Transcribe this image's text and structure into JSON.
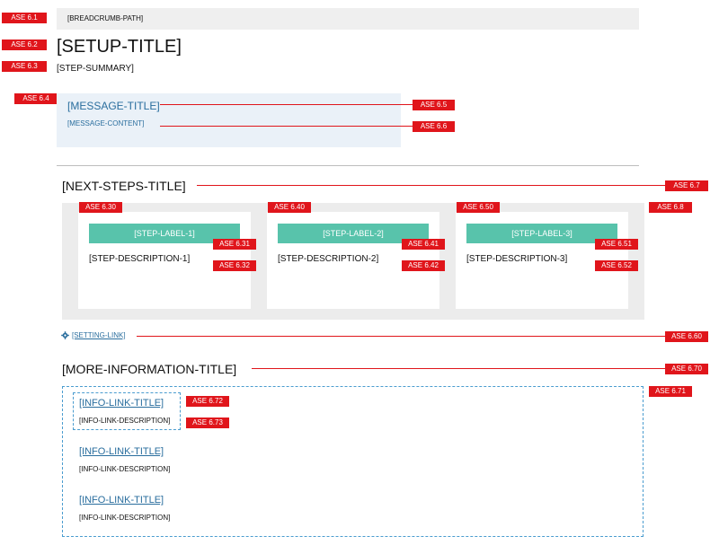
{
  "breadcrumb": "[BREADCRUMB-PATH]",
  "setup_title": "[SETUP-TITLE]",
  "step_summary": "[STEP-SUMMARY]",
  "message": {
    "title": "[MESSAGE-TITLE]",
    "content": "[MESSAGE-CONTENT]"
  },
  "next_steps": {
    "title": "[NEXT-STEPS-TITLE]",
    "steps": [
      {
        "label": "[STEP-LABEL-1]",
        "description": "[STEP-DESCRIPTION-1]"
      },
      {
        "label": "[STEP-LABEL-2]",
        "description": "[STEP-DESCRIPTION-2]"
      },
      {
        "label": "[STEP-LABEL-3]",
        "description": "[STEP-DESCRIPTION-3]"
      }
    ]
  },
  "setting_link": "[SETTING-LINK]",
  "more_information": {
    "title": "[MORE-INFORMATION-TITLE]",
    "links": [
      {
        "title": "[INFO-LINK-TITLE]",
        "description": "[INFO-LINK-DESCRIPTION]"
      },
      {
        "title": "[INFO-LINK-TITLE]",
        "description": "[INFO-LINK-DESCRIPTION]"
      },
      {
        "title": "[INFO-LINK-TITLE]",
        "description": "[INFO-LINK-DESCRIPTION]"
      }
    ]
  },
  "annotations": {
    "a6_1": "ASE 6.1",
    "a6_2": "ASE 6.2",
    "a6_3": "ASE 6.3",
    "a6_4": "ASE 6.4",
    "a6_5": "ASE 6.5",
    "a6_6": "ASE 6.6",
    "a6_7": "ASE 6.7",
    "a6_8": "ASE 6.8",
    "a6_30": "ASE 6.30",
    "a6_31": "ASE 6.31",
    "a6_32": "ASE 6.32",
    "a6_40": "ASE 6.40",
    "a6_41": "ASE 6.41",
    "a6_42": "ASE 6.42",
    "a6_50": "ASE 6.50",
    "a6_51": "ASE 6.51",
    "a6_52": "ASE 6.52",
    "a6_60": "ASE 6.60",
    "a6_70": "ASE 6.70",
    "a6_71": "ASE 6.71",
    "a6_72": "ASE 6.72",
    "a6_73": "ASE 6.73"
  },
  "colors": {
    "annotation": "#e0151b",
    "step_label": "#58c3ab",
    "link": "#2a6e9e",
    "message_bg": "#eaf1f8"
  }
}
